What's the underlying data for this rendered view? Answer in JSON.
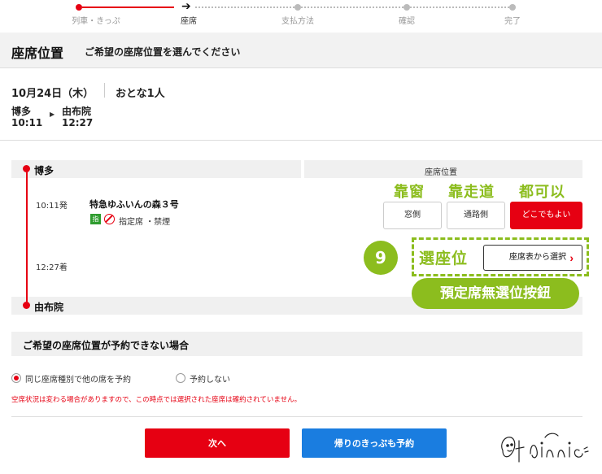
{
  "stepper": {
    "steps": [
      {
        "label": "列車・きっぷ",
        "state": "done"
      },
      {
        "label": "座席",
        "state": "current"
      },
      {
        "label": "支払方法",
        "state": "todo"
      },
      {
        "label": "確認",
        "state": "todo"
      },
      {
        "label": "完了",
        "state": "todo"
      }
    ]
  },
  "header": {
    "title": "座席位置",
    "subtitle": "ご希望の座席位置を選んでください"
  },
  "trip": {
    "date": "10月24日（木）",
    "passengers": "おとな1人",
    "departure_station": "博多",
    "departure_time": "10:11",
    "arrival_station": "由布院",
    "arrival_time": "12:27"
  },
  "train_panel": {
    "from_station": "博多",
    "to_station": "由布院",
    "seat_position_header": "座席位置",
    "depart_label": "10:11発",
    "arrive_label": "12:27着",
    "train_name": "特急ゆふいんの森３号",
    "reserved_tag": "指",
    "seat_type": "指定席 ・禁煙",
    "seat_options": [
      {
        "label": "窓側",
        "selected": false
      },
      {
        "label": "通路側",
        "selected": false
      },
      {
        "label": "どこでもよい",
        "selected": true
      }
    ],
    "seat_map_button": "座席表から選択"
  },
  "annotations": {
    "window_note": "靠窗",
    "aisle_note": "靠走道",
    "any_note": "都可以",
    "step_number": "9",
    "select_seat_note": "選座位",
    "pill_note": "預定席無選位按鈕"
  },
  "fallback": {
    "title": "ご希望の座席位置が予約できない場合",
    "options": [
      {
        "label": "同じ座席種別で他の席を予約",
        "checked": true
      },
      {
        "label": "予約しない",
        "checked": false
      }
    ],
    "warning": "空席状況は変わる場合がありますので、この時点では選択された座席は確約されていません。"
  },
  "actions": {
    "next_label": "次へ",
    "return_ticket_label": "帰りのきっぷも予約"
  },
  "colors": {
    "brand_red": "#e60012",
    "action_blue": "#1a7de0",
    "annotation_green": "#8cbd1e"
  }
}
